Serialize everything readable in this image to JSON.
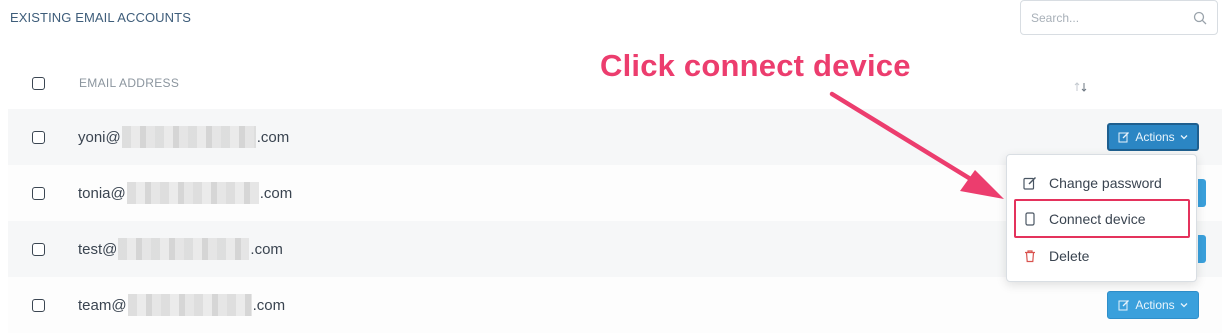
{
  "panel": {
    "title": "EXISTING EMAIL ACCOUNTS"
  },
  "search": {
    "placeholder": "Search..."
  },
  "table": {
    "column_header": "EMAIL ADDRESS",
    "rows": [
      {
        "prefix": "yoni@",
        "suffix": ".com"
      },
      {
        "prefix": "tonia@",
        "suffix": ".com"
      },
      {
        "prefix": "test@",
        "suffix": ".com"
      },
      {
        "prefix": "team@",
        "suffix": ".com"
      }
    ]
  },
  "actions": {
    "label": "Actions"
  },
  "dropdown": {
    "items": [
      {
        "label": "Change password",
        "icon": "edit-icon"
      },
      {
        "label": "Connect device",
        "icon": "mobile-icon"
      },
      {
        "label": "Delete",
        "icon": "trash-icon"
      }
    ]
  },
  "annotation": {
    "text": "Click connect device"
  },
  "colors": {
    "accent": "#3aa0dc",
    "accent_active": "#2b86c4",
    "annotation": "#ec3d6e",
    "delete": "#d9534f"
  }
}
